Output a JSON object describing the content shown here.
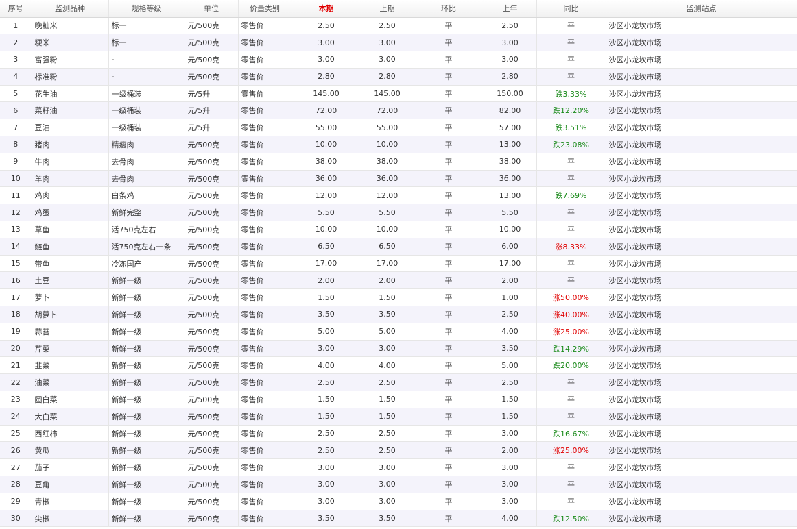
{
  "columns": [
    "序号",
    "监测品种",
    "规格等级",
    "单位",
    "价量类别",
    "本期",
    "上期",
    "环比",
    "上年",
    "同比",
    "监测站点"
  ],
  "colors": {
    "header_highlight": "#e00000",
    "rise": "#e00000",
    "fall": "#1a8a1a",
    "row_alt": "#f4f3fb"
  },
  "rows": [
    [
      "1",
      "晚籼米",
      "标一",
      "元/500克",
      "零售价",
      "2.50",
      "2.50",
      "平",
      "2.50",
      "平",
      "沙区小龙坎市场"
    ],
    [
      "2",
      "粳米",
      "标一",
      "元/500克",
      "零售价",
      "3.00",
      "3.00",
      "平",
      "3.00",
      "平",
      "沙区小龙坎市场"
    ],
    [
      "3",
      "富强粉",
      "-",
      "元/500克",
      "零售价",
      "3.00",
      "3.00",
      "平",
      "3.00",
      "平",
      "沙区小龙坎市场"
    ],
    [
      "4",
      "标准粉",
      "-",
      "元/500克",
      "零售价",
      "2.80",
      "2.80",
      "平",
      "2.80",
      "平",
      "沙区小龙坎市场"
    ],
    [
      "5",
      "花生油",
      "一级桶装",
      "元/5升",
      "零售价",
      "145.00",
      "145.00",
      "平",
      "150.00",
      "跌3.33%",
      "沙区小龙坎市场"
    ],
    [
      "6",
      "菜籽油",
      "一级桶装",
      "元/5升",
      "零售价",
      "72.00",
      "72.00",
      "平",
      "82.00",
      "跌12.20%",
      "沙区小龙坎市场"
    ],
    [
      "7",
      "豆油",
      "一级桶装",
      "元/5升",
      "零售价",
      "55.00",
      "55.00",
      "平",
      "57.00",
      "跌3.51%",
      "沙区小龙坎市场"
    ],
    [
      "8",
      "猪肉",
      "精瘦肉",
      "元/500克",
      "零售价",
      "10.00",
      "10.00",
      "平",
      "13.00",
      "跌23.08%",
      "沙区小龙坎市场"
    ],
    [
      "9",
      "牛肉",
      "去骨肉",
      "元/500克",
      "零售价",
      "38.00",
      "38.00",
      "平",
      "38.00",
      "平",
      "沙区小龙坎市场"
    ],
    [
      "10",
      "羊肉",
      "去骨肉",
      "元/500克",
      "零售价",
      "36.00",
      "36.00",
      "平",
      "36.00",
      "平",
      "沙区小龙坎市场"
    ],
    [
      "11",
      "鸡肉",
      "白条鸡",
      "元/500克",
      "零售价",
      "12.00",
      "12.00",
      "平",
      "13.00",
      "跌7.69%",
      "沙区小龙坎市场"
    ],
    [
      "12",
      "鸡蛋",
      "新鲜完整",
      "元/500克",
      "零售价",
      "5.50",
      "5.50",
      "平",
      "5.50",
      "平",
      "沙区小龙坎市场"
    ],
    [
      "13",
      "草鱼",
      "活750克左右",
      "元/500克",
      "零售价",
      "10.00",
      "10.00",
      "平",
      "10.00",
      "平",
      "沙区小龙坎市场"
    ],
    [
      "14",
      "鲢鱼",
      "活750克左右一条",
      "元/500克",
      "零售价",
      "6.50",
      "6.50",
      "平",
      "6.00",
      "涨8.33%",
      "沙区小龙坎市场"
    ],
    [
      "15",
      "带鱼",
      "冷冻国产",
      "元/500克",
      "零售价",
      "17.00",
      "17.00",
      "平",
      "17.00",
      "平",
      "沙区小龙坎市场"
    ],
    [
      "16",
      "土豆",
      "新鲜一级",
      "元/500克",
      "零售价",
      "2.00",
      "2.00",
      "平",
      "2.00",
      "平",
      "沙区小龙坎市场"
    ],
    [
      "17",
      "萝卜",
      "新鲜一级",
      "元/500克",
      "零售价",
      "1.50",
      "1.50",
      "平",
      "1.00",
      "涨50.00%",
      "沙区小龙坎市场"
    ],
    [
      "18",
      "胡萝卜",
      "新鲜一级",
      "元/500克",
      "零售价",
      "3.50",
      "3.50",
      "平",
      "2.50",
      "涨40.00%",
      "沙区小龙坎市场"
    ],
    [
      "19",
      "蒜苔",
      "新鲜一级",
      "元/500克",
      "零售价",
      "5.00",
      "5.00",
      "平",
      "4.00",
      "涨25.00%",
      "沙区小龙坎市场"
    ],
    [
      "20",
      "芹菜",
      "新鲜一级",
      "元/500克",
      "零售价",
      "3.00",
      "3.00",
      "平",
      "3.50",
      "跌14.29%",
      "沙区小龙坎市场"
    ],
    [
      "21",
      "韭菜",
      "新鲜一级",
      "元/500克",
      "零售价",
      "4.00",
      "4.00",
      "平",
      "5.00",
      "跌20.00%",
      "沙区小龙坎市场"
    ],
    [
      "22",
      "油菜",
      "新鲜一级",
      "元/500克",
      "零售价",
      "2.50",
      "2.50",
      "平",
      "2.50",
      "平",
      "沙区小龙坎市场"
    ],
    [
      "23",
      "圆白菜",
      "新鲜一级",
      "元/500克",
      "零售价",
      "1.50",
      "1.50",
      "平",
      "1.50",
      "平",
      "沙区小龙坎市场"
    ],
    [
      "24",
      "大白菜",
      "新鲜一级",
      "元/500克",
      "零售价",
      "1.50",
      "1.50",
      "平",
      "1.50",
      "平",
      "沙区小龙坎市场"
    ],
    [
      "25",
      "西红柿",
      "新鲜一级",
      "元/500克",
      "零售价",
      "2.50",
      "2.50",
      "平",
      "3.00",
      "跌16.67%",
      "沙区小龙坎市场"
    ],
    [
      "26",
      "黄瓜",
      "新鲜一级",
      "元/500克",
      "零售价",
      "2.50",
      "2.50",
      "平",
      "2.00",
      "涨25.00%",
      "沙区小龙坎市场"
    ],
    [
      "27",
      "茄子",
      "新鲜一级",
      "元/500克",
      "零售价",
      "3.00",
      "3.00",
      "平",
      "3.00",
      "平",
      "沙区小龙坎市场"
    ],
    [
      "28",
      "豆角",
      "新鲜一级",
      "元/500克",
      "零售价",
      "3.00",
      "3.00",
      "平",
      "3.00",
      "平",
      "沙区小龙坎市场"
    ],
    [
      "29",
      "青椒",
      "新鲜一级",
      "元/500克",
      "零售价",
      "3.00",
      "3.00",
      "平",
      "3.00",
      "平",
      "沙区小龙坎市场"
    ],
    [
      "30",
      "尖椒",
      "新鲜一级",
      "元/500克",
      "零售价",
      "3.50",
      "3.50",
      "平",
      "4.00",
      "跌12.50%",
      "沙区小龙坎市场"
    ]
  ]
}
